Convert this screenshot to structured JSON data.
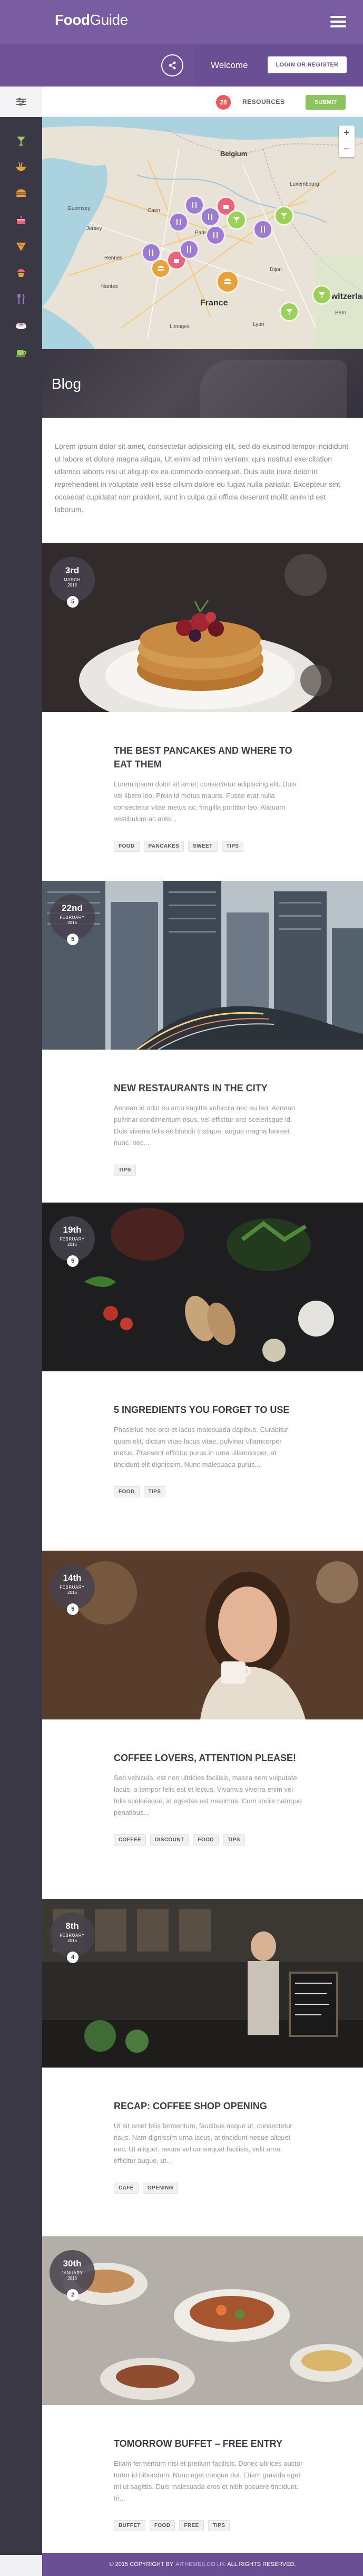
{
  "header": {
    "brand_bold": "Food",
    "brand_light": "Guide",
    "menu_icon": "hamburger-icon"
  },
  "subheader": {
    "share_icon": "share-icon",
    "welcome": "Welcome",
    "login_label": "LOGIN OR REGISTER"
  },
  "filterbar": {
    "filter_icon": "sliders-icon",
    "resources_count": "28",
    "resources_label": "RESOURCES",
    "submit_label": "SUBMIT"
  },
  "sidebar": {
    "items": [
      {
        "icon": "cocktail-icon",
        "color": "#9bd05a"
      },
      {
        "icon": "noodles-icon",
        "color": "#e8a23c"
      },
      {
        "icon": "burger-icon",
        "color": "#e8a23c"
      },
      {
        "icon": "cake-icon",
        "color": "#e6657a"
      },
      {
        "icon": "pizza-icon",
        "color": "#e8a23c"
      },
      {
        "icon": "cupcake-icon",
        "color": "#e6657a"
      },
      {
        "icon": "cutlery-icon",
        "color": "#9c7bd0"
      },
      {
        "icon": "sushi-icon",
        "color": "#ffffff"
      },
      {
        "icon": "coffee-icon",
        "color": "#9bd05a"
      }
    ]
  },
  "map": {
    "labels": [
      {
        "text": "Belgium"
      },
      {
        "text": "Guernsey"
      },
      {
        "text": "Jersey"
      },
      {
        "text": "Luxembourg"
      },
      {
        "text": "France"
      },
      {
        "text": "Switzerlan"
      },
      {
        "text": "Limoges"
      },
      {
        "text": "Lyon"
      },
      {
        "text": "Paris"
      },
      {
        "text": "Nantes"
      },
      {
        "text": "Rennes"
      },
      {
        "text": "Dijon"
      },
      {
        "text": "Caen"
      },
      {
        "text": "Bern"
      }
    ],
    "zoom_in": "+",
    "zoom_out": "−"
  },
  "blog": {
    "title": "Blog",
    "intro": "Lorem ipsum dolor sit amet, consectetur adipisicing elit, sed do eiusmod tempor incididunt ut labore et dolore magna aliqua. Ut enim ad minim veniam, quis nostrud exercitation ullamco laboris nisi ut aliquip ex ea commodo consequat. Duis aute irure dolor in reprehenderit in voluptate velit esse cillum dolore eu fugiat nulla pariatur. Excepteur sint occaecat cupidatat non proident, sunt in culpa qui officia deserunt mollit anim id est laborum."
  },
  "posts": [
    {
      "day": "3rd",
      "month": "MARCH",
      "year": "2016",
      "comments": "5",
      "title": "THE BEST PANCAKES AND WHERE TO EAT THEM",
      "excerpt": "Lorem ipsum dolor sit amet, consectetur adipiscing elit. Duis vel libero leo. Proin id metus mauris. Fusce erat nulla consectetur vitae metus ac, fringilla porttitor leo. Aliquam vestibulum ac ante...",
      "tags": [
        "FOOD",
        "PANCAKES",
        "SWEET",
        "TIPS"
      ]
    },
    {
      "day": "22nd",
      "month": "FEBRUARY",
      "year": "2016",
      "comments": "5",
      "title": "NEW RESTAURANTS IN THE CITY",
      "excerpt": "Aenean id odio eu arcu sagittis vehicula nec eu leo. Aenean pulvinar condimentum risus, vel efficitur orci scelerisque id. Duis viverra felis ac blandit tristique, augue magna laoreet nunc, nec...",
      "tags": [
        "TIPS"
      ]
    },
    {
      "day": "19th",
      "month": "FEBRUARY",
      "year": "2016",
      "comments": "5",
      "title": "5 INGREDIENTS YOU FORGET TO USE",
      "excerpt": "Phasellus nec orci et lacus malesuada dapibus. Curabitur quam elit, dictum vitae lacus vitae, pulvinar ullamcorper metus. Praesent efficitur purus in urna ullamcorper, at tincidunt elit dignissim. Nunc malesuada purus...",
      "tags": [
        "FOOD",
        "TIPS"
      ]
    },
    {
      "day": "14th",
      "month": "FEBRUARY",
      "year": "2016",
      "comments": "5",
      "title": "COFFEE LOVERS, ATTENTION PLEASE!",
      "excerpt": "Sed vehicula, est non ultricies facilisis, massa sem vulputate lacus, a tempor felis est et lectus. Vivamus viverra enim vel felis scelerisque, id egestas est maximus. Cum sociis natoque penatibus...",
      "tags": [
        "COFFEE",
        "DISCOUNT",
        "FOOD",
        "TIPS"
      ]
    },
    {
      "day": "8th",
      "month": "FEBRUARY",
      "year": "2016",
      "comments": "4",
      "title": "RECAP: COFFEE SHOP OPENING",
      "excerpt": "Ut sit amet felis fermentum, faucibus neque ut, consectetur risus. Nam dignissim urna lacus, at tincidunt neque aliquet nec. Ut aliquet, neque vel consequat facilisis, velit urna efficitur augue, ut...",
      "tags": [
        "CAFÉ",
        "OPENING"
      ]
    },
    {
      "day": "30th",
      "month": "JANUARY",
      "year": "2016",
      "comments": "2",
      "title": "TOMORROW BUFFET – FREE ENTRY",
      "excerpt": "Etiam fermentum nisi et pretium facilisis. Donec ultrices auctor tortor id bibendum. Nunc eget congue dui. Etiam gravida eget mi ut sagittis. Duis malesuada eros et nibh posuere tincidunt. In...",
      "tags": [
        "BUFFET",
        "FOOD",
        "FREE",
        "TIPS"
      ]
    }
  ],
  "footer": {
    "prefix": "© 2015 COPYRIGHT BY",
    "brand": "AITHEMES.CO.UK",
    "suffix": "ALL RIGHTS RESERVED."
  }
}
